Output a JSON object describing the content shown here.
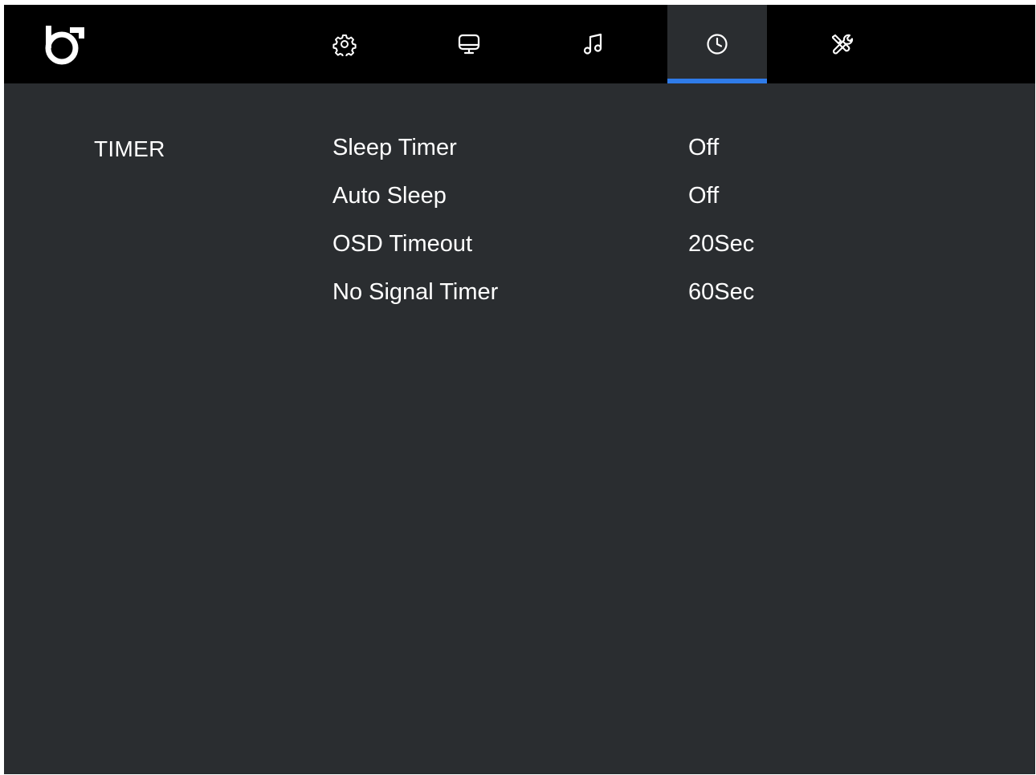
{
  "header": {
    "logo_icon": "brand-logo-icon",
    "tabs": [
      {
        "icon": "gear-icon",
        "name": "settings"
      },
      {
        "icon": "monitor-icon",
        "name": "display"
      },
      {
        "icon": "music-note-icon",
        "name": "audio"
      },
      {
        "icon": "clock-icon",
        "name": "timer",
        "active": true
      },
      {
        "icon": "tools-icon",
        "name": "system"
      }
    ],
    "active_indicator_color": "#2f7be8"
  },
  "menu": {
    "section_title": "TIMER",
    "items": [
      {
        "label": "Sleep Timer",
        "value": "Off"
      },
      {
        "label": "Auto Sleep",
        "value": "Off"
      },
      {
        "label": "OSD Timeout",
        "value": "20Sec"
      },
      {
        "label": "No Signal Timer",
        "value": "60Sec"
      }
    ]
  },
  "colors": {
    "background": "#2a2d30",
    "topbar": "#000000",
    "text": "#ffffff",
    "accent": "#2f7be8"
  }
}
